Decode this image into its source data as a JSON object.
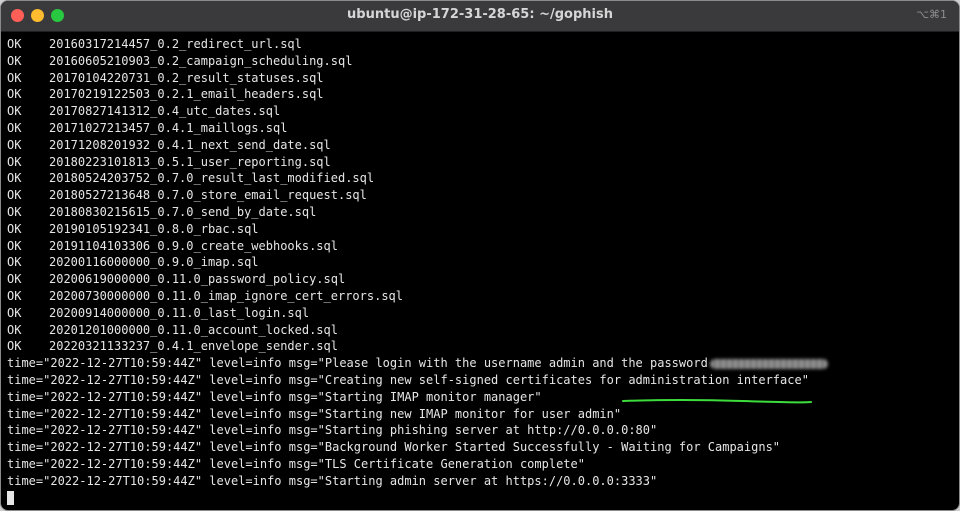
{
  "window": {
    "title": "ubuntu@ip-172-31-28-65: ~/gophish",
    "shortcut": "⌥⌘1"
  },
  "terminal": {
    "migrations": [
      {
        "status": "OK",
        "file": "20160317214457_0.2_redirect_url.sql"
      },
      {
        "status": "OK",
        "file": "20160605210903_0.2_campaign_scheduling.sql"
      },
      {
        "status": "OK",
        "file": "20170104220731_0.2_result_statuses.sql"
      },
      {
        "status": "OK",
        "file": "20170219122503_0.2.1_email_headers.sql"
      },
      {
        "status": "OK",
        "file": "20170827141312_0.4_utc_dates.sql"
      },
      {
        "status": "OK",
        "file": "20171027213457_0.4.1_maillogs.sql"
      },
      {
        "status": "OK",
        "file": "20171208201932_0.4.1_next_send_date.sql"
      },
      {
        "status": "OK",
        "file": "20180223101813_0.5.1_user_reporting.sql"
      },
      {
        "status": "OK",
        "file": "20180524203752_0.7.0_result_last_modified.sql"
      },
      {
        "status": "OK",
        "file": "20180527213648_0.7.0_store_email_request.sql"
      },
      {
        "status": "OK",
        "file": "20180830215615_0.7.0_send_by_date.sql"
      },
      {
        "status": "OK",
        "file": "20190105192341_0.8.0_rbac.sql"
      },
      {
        "status": "OK",
        "file": "20191104103306_0.9.0_create_webhooks.sql"
      },
      {
        "status": "OK",
        "file": "20200116000000_0.9.0_imap.sql"
      },
      {
        "status": "OK",
        "file": "20200619000000_0.11.0_password_policy.sql"
      },
      {
        "status": "OK",
        "file": "20200730000000_0.11.0_imap_ignore_cert_errors.sql"
      },
      {
        "status": "OK",
        "file": "20200914000000_0.11.0_last_login.sql"
      },
      {
        "status": "OK",
        "file": "20201201000000_0.11.0_account_locked.sql"
      },
      {
        "status": "OK",
        "file": "20220321133237_0.4.1_envelope_sender.sql"
      }
    ],
    "logs": [
      "time=\"2022-12-27T10:59:44Z\" level=info msg=\"Please login with the username admin and the password",
      "time=\"2022-12-27T10:59:44Z\" level=info msg=\"Creating new self-signed certificates for administration interface\"",
      "time=\"2022-12-27T10:59:44Z\" level=info msg=\"Starting IMAP monitor manager\"",
      "time=\"2022-12-27T10:59:44Z\" level=info msg=\"Starting new IMAP monitor for user admin\"",
      "time=\"2022-12-27T10:59:44Z\" level=info msg=\"Starting phishing server at http://0.0.0.0:80\"",
      "time=\"2022-12-27T10:59:44Z\" level=info msg=\"Background Worker Started Successfully - Waiting for Campaigns\"",
      "time=\"2022-12-27T10:59:44Z\" level=info msg=\"TLS Certificate Generation complete\"",
      "time=\"2022-12-27T10:59:44Z\" level=info msg=\"Starting admin server at https://0.0.0.0:3333\""
    ]
  },
  "colors": {
    "background": "#000000",
    "text": "#e6e6e6",
    "annotation": "#3ddc3d"
  }
}
